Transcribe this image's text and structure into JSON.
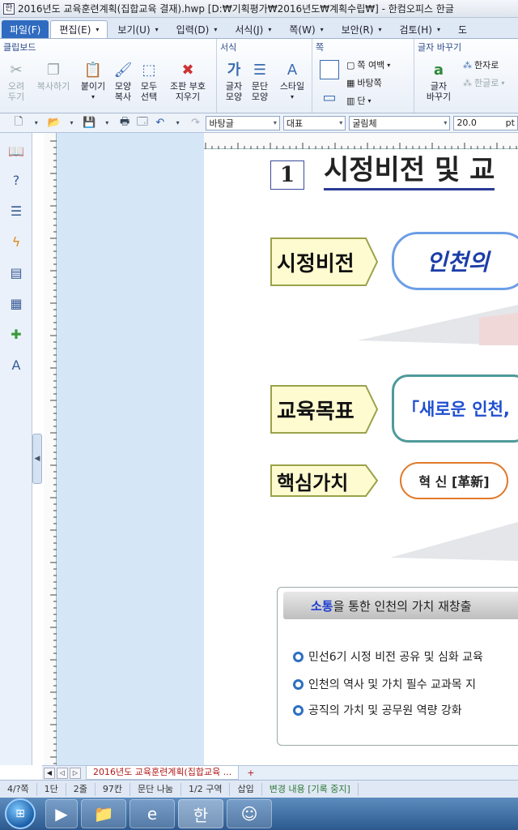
{
  "window": {
    "title": "2016년도 교육훈련계획(집합교육 결재).hwp [D:₩기획평가₩2016년도₩계획수립₩] - 한컴오피스 한글"
  },
  "menu": [
    {
      "label": "파일(F)"
    },
    {
      "label": "편집(E)"
    },
    {
      "label": "보기(U)"
    },
    {
      "label": "입력(D)"
    },
    {
      "label": "서식(J)"
    },
    {
      "label": "쪽(W)"
    },
    {
      "label": "보안(R)"
    },
    {
      "label": "검토(H)"
    },
    {
      "label": "도"
    }
  ],
  "ribbon": {
    "clipboard": {
      "title": "클립보드",
      "cut": "오려\n두기",
      "copy": "복사하기",
      "paste": "붙이기",
      "format_copy": "모양\n복사",
      "select_all": "모두\n선택",
      "special": "조판 부호\n지우기"
    },
    "format": {
      "title": "서식",
      "char": "글자\n모양",
      "para": "문단\n모양",
      "style": "스타일"
    },
    "page": {
      "title": "쪽",
      "margin": "쪽 여백",
      "background": "바탕쪽",
      "columns": "단"
    },
    "convert": {
      "title": "글자 바꾸기",
      "convert": "글자\n바꾸기",
      "hanja": "한자로",
      "hangul": "한글로"
    }
  },
  "toolbar": {
    "style": "바탕글",
    "font_lang": "대표",
    "font": "굴림체",
    "size": "20.0",
    "unit": "pt"
  },
  "document": {
    "section_number": "1",
    "section_title": "시정비전 및 교",
    "vision_label": "시정비전",
    "vision_text": "인천의",
    "goal_label": "교육목표",
    "goal_text": "「새로운 인천,",
    "value_label": "핵심가치",
    "value_item": "혁 신 [革新]",
    "panel_header_highlight": "소통",
    "panel_header_rest": "을 통한 인천의 가치 재창출",
    "bullets": [
      "민선6기 시정 비전 공유 및 심화 교육",
      "인천의 역사 및 가치 필수 교과목 지",
      "공직의 가치 및 공무원 역량 강화"
    ]
  },
  "tabs": {
    "doc_tab": "2016년도 교육훈련계획(집합교육 ...",
    "new_tab_icon": "+"
  },
  "status": [
    "4/?쪽",
    "1단",
    "2줄",
    "97칸",
    "문단 나눔",
    "1/2 구역",
    "삽입",
    "변경 내용 [기록 중지]"
  ],
  "colors": {
    "accent": "#2f6bc0",
    "label_fill": "#fffbd0",
    "label_border": "#9aa24a",
    "vision_border": "#6b9ee6",
    "goal_border": "#4f9a9a",
    "value_border": "#e07a2a",
    "goal_text": "#1f4fd0"
  }
}
